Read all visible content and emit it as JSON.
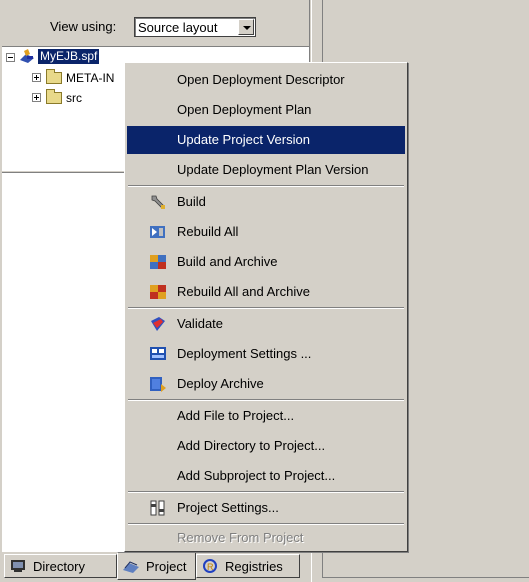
{
  "view_using": {
    "label": "View using:",
    "selected": "Source layout"
  },
  "tree": {
    "root": "MyEJB.spf",
    "children": [
      "META-IN",
      "src"
    ]
  },
  "tabs": [
    {
      "label": "Directory",
      "icon": "directory-icon"
    },
    {
      "label": "Project",
      "icon": "project-icon"
    },
    {
      "label": "Registries",
      "icon": "registries-icon"
    }
  ],
  "menu": {
    "items": [
      {
        "label": "Open Deployment Descriptor",
        "icon": null
      },
      {
        "label": "Open Deployment Plan",
        "icon": null
      },
      {
        "label": "Update Project Version",
        "icon": null
      },
      {
        "label": "Update Deployment Plan Version",
        "icon": null
      },
      {
        "label": "Build",
        "icon": "wrench-icon"
      },
      {
        "label": "Rebuild All",
        "icon": "rebuild-all-icon"
      },
      {
        "label": "Build and Archive",
        "icon": "build-archive-icon"
      },
      {
        "label": "Rebuild All and Archive",
        "icon": "rebuild-archive-icon"
      },
      {
        "label": "Validate",
        "icon": "validate-icon"
      },
      {
        "label": "Deployment Settings ...",
        "icon": "deployment-settings-icon"
      },
      {
        "label": "Deploy Archive",
        "icon": "deploy-archive-icon"
      },
      {
        "label": "Add File to Project...",
        "icon": null
      },
      {
        "label": "Add Directory to Project...",
        "icon": null
      },
      {
        "label": "Add Subproject to Project...",
        "icon": null
      },
      {
        "label": "Project Settings...",
        "icon": "project-settings-icon"
      },
      {
        "label": "Remove From Project",
        "icon": null
      }
    ]
  },
  "colors": {
    "highlight": "#0a246a",
    "face": "#d4d0c8"
  }
}
